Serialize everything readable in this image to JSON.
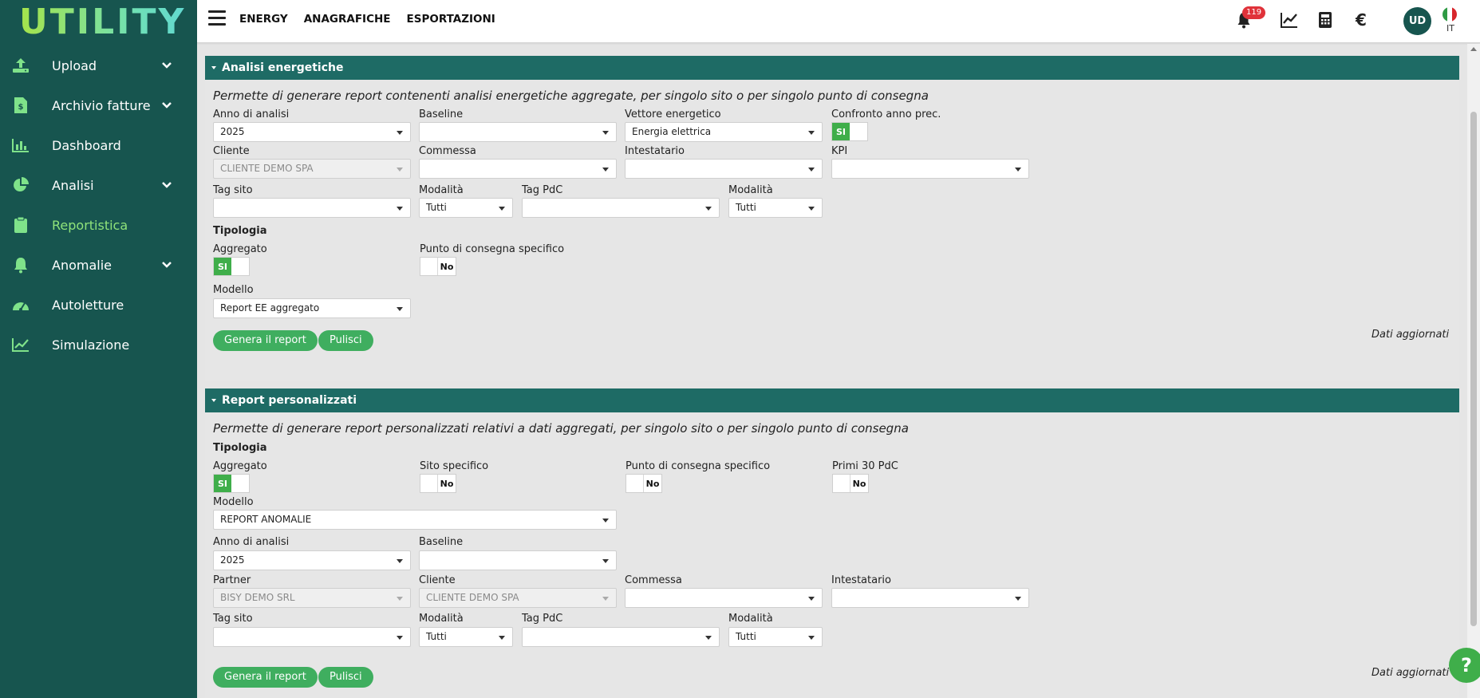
{
  "app": {
    "logo": "UTILITY"
  },
  "sidebar": {
    "items": [
      {
        "label": "Upload",
        "icon": "upload-icon",
        "chevron": true
      },
      {
        "label": "Archivio fatture",
        "icon": "invoice-icon",
        "chevron": true
      },
      {
        "label": "Dashboard",
        "icon": "bar-chart-icon",
        "chevron": false
      },
      {
        "label": "Analisi",
        "icon": "pie-chart-icon",
        "chevron": true
      },
      {
        "label": "Reportistica",
        "icon": "clipboard-icon",
        "chevron": false,
        "active": true
      },
      {
        "label": "Anomalie",
        "icon": "bell-icon",
        "chevron": true
      },
      {
        "label": "Autoletture",
        "icon": "gauge-icon",
        "chevron": false
      },
      {
        "label": "Simulazione",
        "icon": "line-chart-icon",
        "chevron": false
      }
    ]
  },
  "header": {
    "links": [
      "ENERGY",
      "ANAGRAFICHE",
      "ESPORTAZIONI"
    ],
    "notifications": "119",
    "avatar": "UD",
    "lang": "IT"
  },
  "panel1": {
    "title": "Analisi energetiche",
    "description": "Permette di generare report contenenti analisi energetiche aggregate, per singolo sito o per singolo punto di consegna",
    "anno_label": "Anno di analisi",
    "anno_value": "2025",
    "baseline_label": "Baseline",
    "baseline_value": "",
    "vettore_label": "Vettore energetico",
    "vettore_value": "Energia elettrica",
    "confronto_label": "Confronto anno prec.",
    "confronto_value": "SI",
    "cliente_label": "Cliente",
    "cliente_value": "CLIENTE DEMO SPA",
    "commessa_label": "Commessa",
    "commessa_value": "",
    "intestatario_label": "Intestatario",
    "intestatario_value": "",
    "kpi_label": "KPI",
    "kpi_value": "",
    "tagsito_label": "Tag sito",
    "tagsito_value": "",
    "modalita1_label": "Modalità",
    "modalita1_value": "Tutti",
    "tagpdc_label": "Tag PdC",
    "tagpdc_value": "",
    "modalita2_label": "Modalità",
    "modalita2_value": "Tutti",
    "tipologia_label": "Tipologia",
    "aggregato_label": "Aggregato",
    "aggregato_value": "SI",
    "pdc_specifico_label": "Punto di consegna specifico",
    "pdc_specifico_value": "No",
    "modello_label": "Modello",
    "modello_value": "Report EE aggregato",
    "genera_label": "Genera il report",
    "pulisci_label": "Pulisci",
    "updated_label": "Dati aggiornati"
  },
  "panel2": {
    "title": "Report personalizzati",
    "description": "Permette di generare report personalizzati relativi a dati aggregati, per singolo sito o per singolo punto di consegna",
    "tipologia_label": "Tipologia",
    "aggregato_label": "Aggregato",
    "aggregato_value": "SI",
    "sito_specifico_label": "Sito specifico",
    "sito_specifico_value": "No",
    "pdc_specifico_label": "Punto di consegna specifico",
    "pdc_specifico_value": "No",
    "primi30_label": "Primi 30 PdC",
    "primi30_value": "No",
    "modello_label": "Modello",
    "modello_value": "REPORT ANOMALIE",
    "anno_label": "Anno di analisi",
    "anno_value": "2025",
    "baseline_label": "Baseline",
    "baseline_value": "",
    "partner_label": "Partner",
    "partner_value": "BISY DEMO SRL",
    "cliente_label": "Cliente",
    "cliente_value": "CLIENTE DEMO SPA",
    "commessa_label": "Commessa",
    "commessa_value": "",
    "intestatario_label": "Intestatario",
    "intestatario_value": "",
    "tagsito_label": "Tag sito",
    "tagsito_value": "",
    "modalita1_label": "Modalità",
    "modalita1_value": "Tutti",
    "tagpdc_label": "Tag PdC",
    "tagpdc_value": "",
    "modalita2_label": "Modalità",
    "modalita2_value": "Tutti",
    "genera_label": "Genera il report",
    "pulisci_label": "Pulisci",
    "updated_label": "Dati aggiornati"
  },
  "help": {
    "label": "?"
  },
  "colors": {
    "sidebar": "#17554f",
    "panel_header": "#1e6b65",
    "accent_green": "#3fae4a",
    "active_nav": "#8fe37a",
    "badge": "#e0323a"
  }
}
